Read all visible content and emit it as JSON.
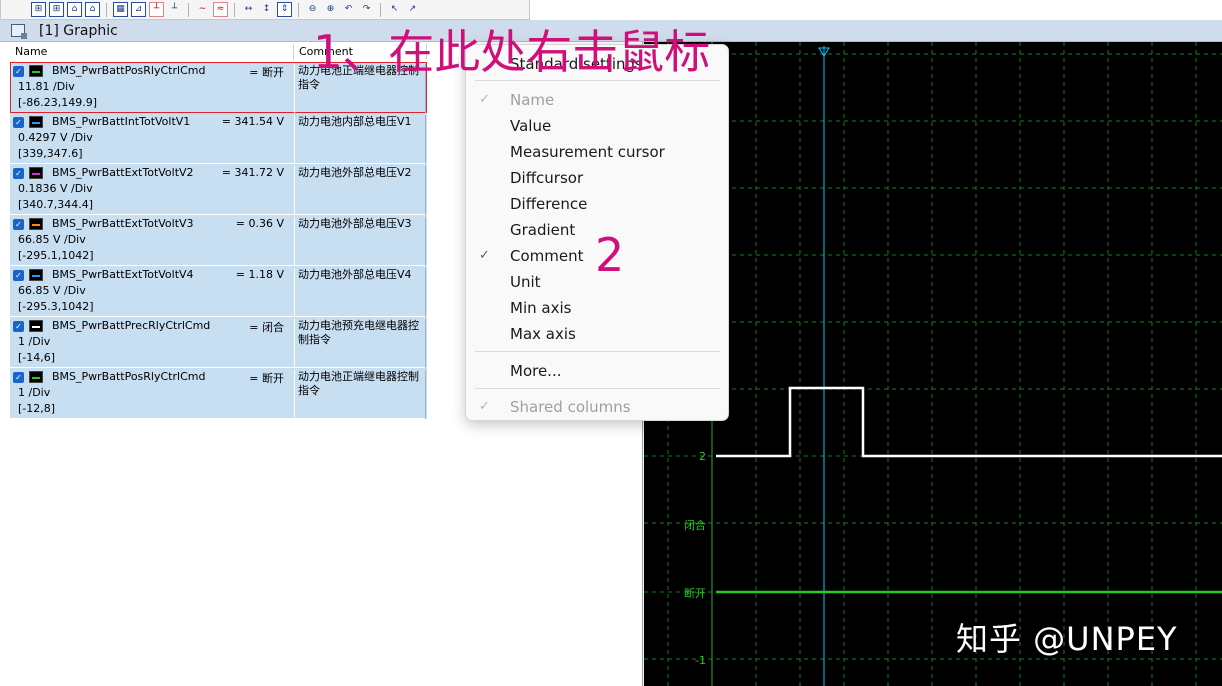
{
  "toolbar": {
    "icons": [
      "channel-icon",
      "channel-icon",
      "chart-icon",
      "chart-icon",
      "grid-icon",
      "chart-icon",
      "cursor-icon",
      "cursor-icon",
      "wave-icon",
      "wave-icon",
      "expand-x-icon",
      "expand-y-icon",
      "fit-icon",
      "zoom-out-icon",
      "zoom-in-icon",
      "undo-icon",
      "redo-icon",
      "nav-back-icon",
      "nav-forward-icon"
    ]
  },
  "window": {
    "title": "[1] Graphic"
  },
  "list": {
    "columns": {
      "name": "Name",
      "comment": "Comment"
    },
    "rows": [
      {
        "name": "BMS_PwrBattPosRlyCtrlCmd",
        "value": "= 断开",
        "div": "11.81  /Div",
        "range": "[-86.23,149.9]",
        "comment": "动力电池正端继电器控制指令",
        "color": "#22cc22"
      },
      {
        "name": "BMS_PwrBattIntTotVoltV1",
        "value": "= 341.54 V",
        "div": "0.4297 V /Div",
        "range": "[339,347.6]",
        "comment": "动力电池内部总电压V1",
        "color": "#2299ff"
      },
      {
        "name": "BMS_PwrBattExtTotVoltV2",
        "value": "= 341.72 V",
        "div": "0.1836 V /Div",
        "range": "[340.7,344.4]",
        "comment": "动力电池外部总电压V2",
        "color": "#d030d0"
      },
      {
        "name": "BMS_PwrBattExtTotVoltV3",
        "value": "= 0.36 V",
        "div": "66.85 V /Div",
        "range": "[-295.1,1042]",
        "comment": "动力电池外部总电压V3",
        "color": "#ff8c00"
      },
      {
        "name": "BMS_PwrBattExtTotVoltV4",
        "value": "= 1.18 V",
        "div": "66.85 V /Div",
        "range": "[-295.3,1042]",
        "comment": "动力电池外部总电压V4",
        "color": "#2299ff"
      },
      {
        "name": "BMS_PwrBattPrecRlyCtrlCmd",
        "value": "= 闭合",
        "div": "1  /Div",
        "range": "[-14,6]",
        "comment": "动力电池预充电继电器控制指令",
        "color": "#ffffff"
      },
      {
        "name": "BMS_PwrBattPosRlyCtrlCmd",
        "value": "= 断开",
        "div": "1  /Div",
        "range": "[-12,8]",
        "comment": "动力电池正端继电器控制指令",
        "color": "#22cc22"
      }
    ]
  },
  "menu": {
    "items": [
      {
        "label": "Standard settings",
        "checked": false,
        "disabled": false
      },
      {
        "label": "Name",
        "checked": true,
        "disabled": true
      },
      {
        "label": "Value",
        "checked": false,
        "disabled": false
      },
      {
        "label": "Measurement cursor",
        "checked": false,
        "disabled": false
      },
      {
        "label": "Diffcursor",
        "checked": false,
        "disabled": false
      },
      {
        "label": "Difference",
        "checked": false,
        "disabled": false
      },
      {
        "label": "Gradient",
        "checked": false,
        "disabled": false
      },
      {
        "label": "Comment",
        "checked": true,
        "disabled": false
      },
      {
        "label": "Unit",
        "checked": false,
        "disabled": false
      },
      {
        "label": "Min axis",
        "checked": false,
        "disabled": false
      },
      {
        "label": "Max axis",
        "checked": false,
        "disabled": false
      },
      {
        "label": "More...",
        "checked": false,
        "disabled": false
      },
      {
        "label": "Shared columns",
        "checked": true,
        "disabled": true
      }
    ]
  },
  "graph": {
    "axis_labels": {
      "two": "2",
      "closed": "闭合",
      "open": "断开",
      "minus_one": "-1"
    },
    "background": "#000000",
    "signal_color": "#ffffff",
    "signal_green": "#22cc22",
    "cursor_color": "#00c8ff"
  },
  "annotations": {
    "step1": "1、在此处右击鼠标",
    "step2": "2"
  },
  "watermark": "知乎 @UNPEY"
}
